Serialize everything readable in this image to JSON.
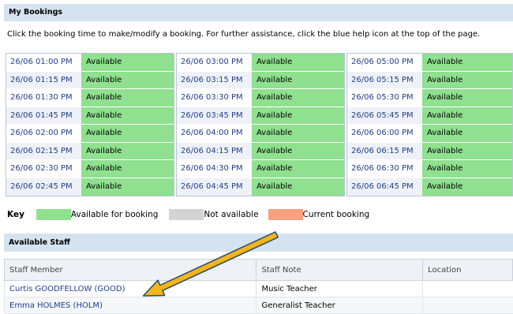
{
  "bookings": {
    "header": "My Bookings",
    "instructions": "Click the booking time to make/modify a booking. For further assistance, click the blue help icon at the top of the page.",
    "columns": [
      {
        "slots": [
          {
            "time": "26/06 01:00 PM",
            "status": "Available"
          },
          {
            "time": "26/06 01:15 PM",
            "status": "Available"
          },
          {
            "time": "26/06 01:30 PM",
            "status": "Available"
          },
          {
            "time": "26/06 01:45 PM",
            "status": "Available"
          },
          {
            "time": "26/06 02:00 PM",
            "status": "Available"
          },
          {
            "time": "26/06 02:15 PM",
            "status": "Available"
          },
          {
            "time": "26/06 02:30 PM",
            "status": "Available"
          },
          {
            "time": "26/06 02:45 PM",
            "status": "Available"
          }
        ]
      },
      {
        "slots": [
          {
            "time": "26/06 03:00 PM",
            "status": "Available"
          },
          {
            "time": "26/06 03:15 PM",
            "status": "Available"
          },
          {
            "time": "26/06 03:30 PM",
            "status": "Available"
          },
          {
            "time": "26/06 03:45 PM",
            "status": "Available"
          },
          {
            "time": "26/06 04:00 PM",
            "status": "Available"
          },
          {
            "time": "26/06 04:15 PM",
            "status": "Available"
          },
          {
            "time": "26/06 04:30 PM",
            "status": "Available"
          },
          {
            "time": "26/06 04:45 PM",
            "status": "Available"
          }
        ]
      },
      {
        "slots": [
          {
            "time": "26/06 05:00 PM",
            "status": "Available"
          },
          {
            "time": "26/06 05:15 PM",
            "status": "Available"
          },
          {
            "time": "26/06 05:30 PM",
            "status": "Available"
          },
          {
            "time": "26/06 05:45 PM",
            "status": "Available"
          },
          {
            "time": "26/06 06:00 PM",
            "status": "Available"
          },
          {
            "time": "26/06 06:15 PM",
            "status": "Available"
          },
          {
            "time": "26/06 06:30 PM",
            "status": "Available"
          },
          {
            "time": "26/06 06:45 PM",
            "status": "Available"
          }
        ]
      }
    ]
  },
  "key": {
    "label": "Key",
    "items": [
      {
        "text": "Available for booking",
        "color": "#8fe08f"
      },
      {
        "text": "Not available",
        "color": "#d3d3d3"
      },
      {
        "text": "Current booking",
        "color": "#f9a07e"
      }
    ]
  },
  "staff": {
    "header": "Available Staff",
    "columns": [
      "Staff Member",
      "Staff Note",
      "Location"
    ],
    "rows": [
      {
        "member": "Curtis GOODFELLOW (GOOD)",
        "note": "Music Teacher",
        "location": ""
      },
      {
        "member": "Emma HOLMES (HOLM)",
        "note": "Generalist Teacher",
        "location": ""
      }
    ]
  },
  "annotation": {
    "arrow_color": "#f2b51a"
  }
}
